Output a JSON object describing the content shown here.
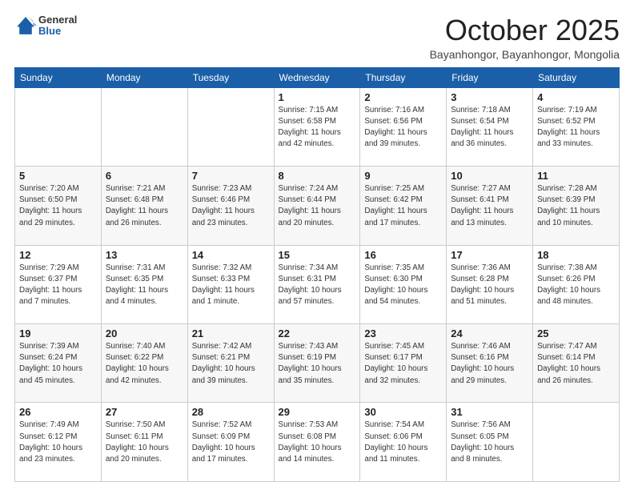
{
  "header": {
    "logo": {
      "general": "General",
      "blue": "Blue"
    },
    "title": "October 2025",
    "subtitle": "Bayanhongor, Bayanhongor, Mongolia"
  },
  "days_of_week": [
    "Sunday",
    "Monday",
    "Tuesday",
    "Wednesday",
    "Thursday",
    "Friday",
    "Saturday"
  ],
  "weeks": [
    [
      {
        "day": "",
        "info": ""
      },
      {
        "day": "",
        "info": ""
      },
      {
        "day": "",
        "info": ""
      },
      {
        "day": "1",
        "info": "Sunrise: 7:15 AM\nSunset: 6:58 PM\nDaylight: 11 hours and 42 minutes."
      },
      {
        "day": "2",
        "info": "Sunrise: 7:16 AM\nSunset: 6:56 PM\nDaylight: 11 hours and 39 minutes."
      },
      {
        "day": "3",
        "info": "Sunrise: 7:18 AM\nSunset: 6:54 PM\nDaylight: 11 hours and 36 minutes."
      },
      {
        "day": "4",
        "info": "Sunrise: 7:19 AM\nSunset: 6:52 PM\nDaylight: 11 hours and 33 minutes."
      }
    ],
    [
      {
        "day": "5",
        "info": "Sunrise: 7:20 AM\nSunset: 6:50 PM\nDaylight: 11 hours and 29 minutes."
      },
      {
        "day": "6",
        "info": "Sunrise: 7:21 AM\nSunset: 6:48 PM\nDaylight: 11 hours and 26 minutes."
      },
      {
        "day": "7",
        "info": "Sunrise: 7:23 AM\nSunset: 6:46 PM\nDaylight: 11 hours and 23 minutes."
      },
      {
        "day": "8",
        "info": "Sunrise: 7:24 AM\nSunset: 6:44 PM\nDaylight: 11 hours and 20 minutes."
      },
      {
        "day": "9",
        "info": "Sunrise: 7:25 AM\nSunset: 6:42 PM\nDaylight: 11 hours and 17 minutes."
      },
      {
        "day": "10",
        "info": "Sunrise: 7:27 AM\nSunset: 6:41 PM\nDaylight: 11 hours and 13 minutes."
      },
      {
        "day": "11",
        "info": "Sunrise: 7:28 AM\nSunset: 6:39 PM\nDaylight: 11 hours and 10 minutes."
      }
    ],
    [
      {
        "day": "12",
        "info": "Sunrise: 7:29 AM\nSunset: 6:37 PM\nDaylight: 11 hours and 7 minutes."
      },
      {
        "day": "13",
        "info": "Sunrise: 7:31 AM\nSunset: 6:35 PM\nDaylight: 11 hours and 4 minutes."
      },
      {
        "day": "14",
        "info": "Sunrise: 7:32 AM\nSunset: 6:33 PM\nDaylight: 11 hours and 1 minute."
      },
      {
        "day": "15",
        "info": "Sunrise: 7:34 AM\nSunset: 6:31 PM\nDaylight: 10 hours and 57 minutes."
      },
      {
        "day": "16",
        "info": "Sunrise: 7:35 AM\nSunset: 6:30 PM\nDaylight: 10 hours and 54 minutes."
      },
      {
        "day": "17",
        "info": "Sunrise: 7:36 AM\nSunset: 6:28 PM\nDaylight: 10 hours and 51 minutes."
      },
      {
        "day": "18",
        "info": "Sunrise: 7:38 AM\nSunset: 6:26 PM\nDaylight: 10 hours and 48 minutes."
      }
    ],
    [
      {
        "day": "19",
        "info": "Sunrise: 7:39 AM\nSunset: 6:24 PM\nDaylight: 10 hours and 45 minutes."
      },
      {
        "day": "20",
        "info": "Sunrise: 7:40 AM\nSunset: 6:22 PM\nDaylight: 10 hours and 42 minutes."
      },
      {
        "day": "21",
        "info": "Sunrise: 7:42 AM\nSunset: 6:21 PM\nDaylight: 10 hours and 39 minutes."
      },
      {
        "day": "22",
        "info": "Sunrise: 7:43 AM\nSunset: 6:19 PM\nDaylight: 10 hours and 35 minutes."
      },
      {
        "day": "23",
        "info": "Sunrise: 7:45 AM\nSunset: 6:17 PM\nDaylight: 10 hours and 32 minutes."
      },
      {
        "day": "24",
        "info": "Sunrise: 7:46 AM\nSunset: 6:16 PM\nDaylight: 10 hours and 29 minutes."
      },
      {
        "day": "25",
        "info": "Sunrise: 7:47 AM\nSunset: 6:14 PM\nDaylight: 10 hours and 26 minutes."
      }
    ],
    [
      {
        "day": "26",
        "info": "Sunrise: 7:49 AM\nSunset: 6:12 PM\nDaylight: 10 hours and 23 minutes."
      },
      {
        "day": "27",
        "info": "Sunrise: 7:50 AM\nSunset: 6:11 PM\nDaylight: 10 hours and 20 minutes."
      },
      {
        "day": "28",
        "info": "Sunrise: 7:52 AM\nSunset: 6:09 PM\nDaylight: 10 hours and 17 minutes."
      },
      {
        "day": "29",
        "info": "Sunrise: 7:53 AM\nSunset: 6:08 PM\nDaylight: 10 hours and 14 minutes."
      },
      {
        "day": "30",
        "info": "Sunrise: 7:54 AM\nSunset: 6:06 PM\nDaylight: 10 hours and 11 minutes."
      },
      {
        "day": "31",
        "info": "Sunrise: 7:56 AM\nSunset: 6:05 PM\nDaylight: 10 hours and 8 minutes."
      },
      {
        "day": "",
        "info": ""
      }
    ]
  ]
}
